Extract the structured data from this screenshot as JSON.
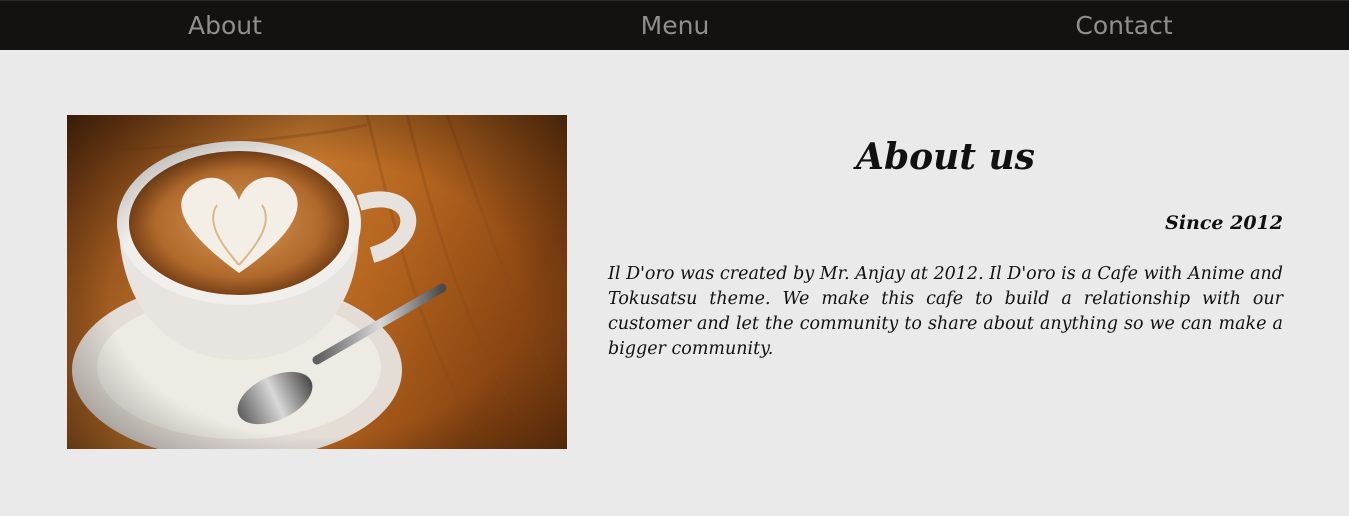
{
  "nav": {
    "items": [
      {
        "label": "About"
      },
      {
        "label": "Menu"
      },
      {
        "label": "Contact"
      }
    ]
  },
  "about": {
    "image_icon": "coffee-latte-photo",
    "title": "About us",
    "since": "Since 2012",
    "description": "Il D'oro was created by Mr. Anjay at 2012. Il D'oro is a Cafe with Anime and Tokusatsu theme. We make this cafe to build a relationship with our customer and let the community to share about anything so we can make a bigger community."
  },
  "colors": {
    "navbar_bg": "#141210",
    "nav_text": "#8f8f8f",
    "page_bg": "#eaeaea",
    "text": "#111111"
  }
}
